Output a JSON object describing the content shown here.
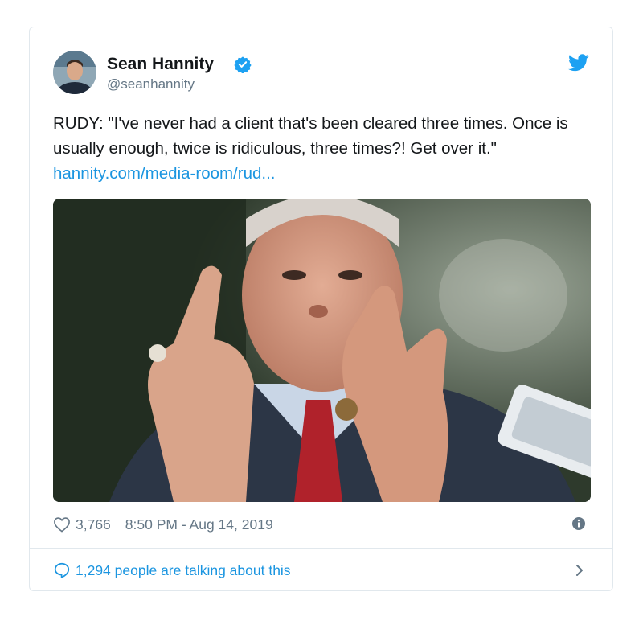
{
  "tweet": {
    "author_name": "Sean Hannity",
    "author_handle": "@seanhannity",
    "text": "RUDY: \"I've never had a client that's been cleared three times. Once is usually enough, twice is ridiculous, three times?! Get over it.\" ",
    "link_text": "hannity.com/media-room/rud...",
    "likes": "3,766",
    "timestamp": "8:50 PM - Aug 14, 2019",
    "talking_text": "1,294 people are talking about this"
  },
  "icons": {
    "verified": "verified-badge-icon",
    "brand": "twitter-bird-icon",
    "like": "heart-icon",
    "info": "info-icon",
    "reply": "speech-bubble-icon",
    "chevron": "chevron-right-icon"
  },
  "colors": {
    "twitter_blue": "#1da1f2",
    "link_blue": "#1b95e0",
    "muted_gray": "#657786",
    "border": "#e1e8ed"
  }
}
